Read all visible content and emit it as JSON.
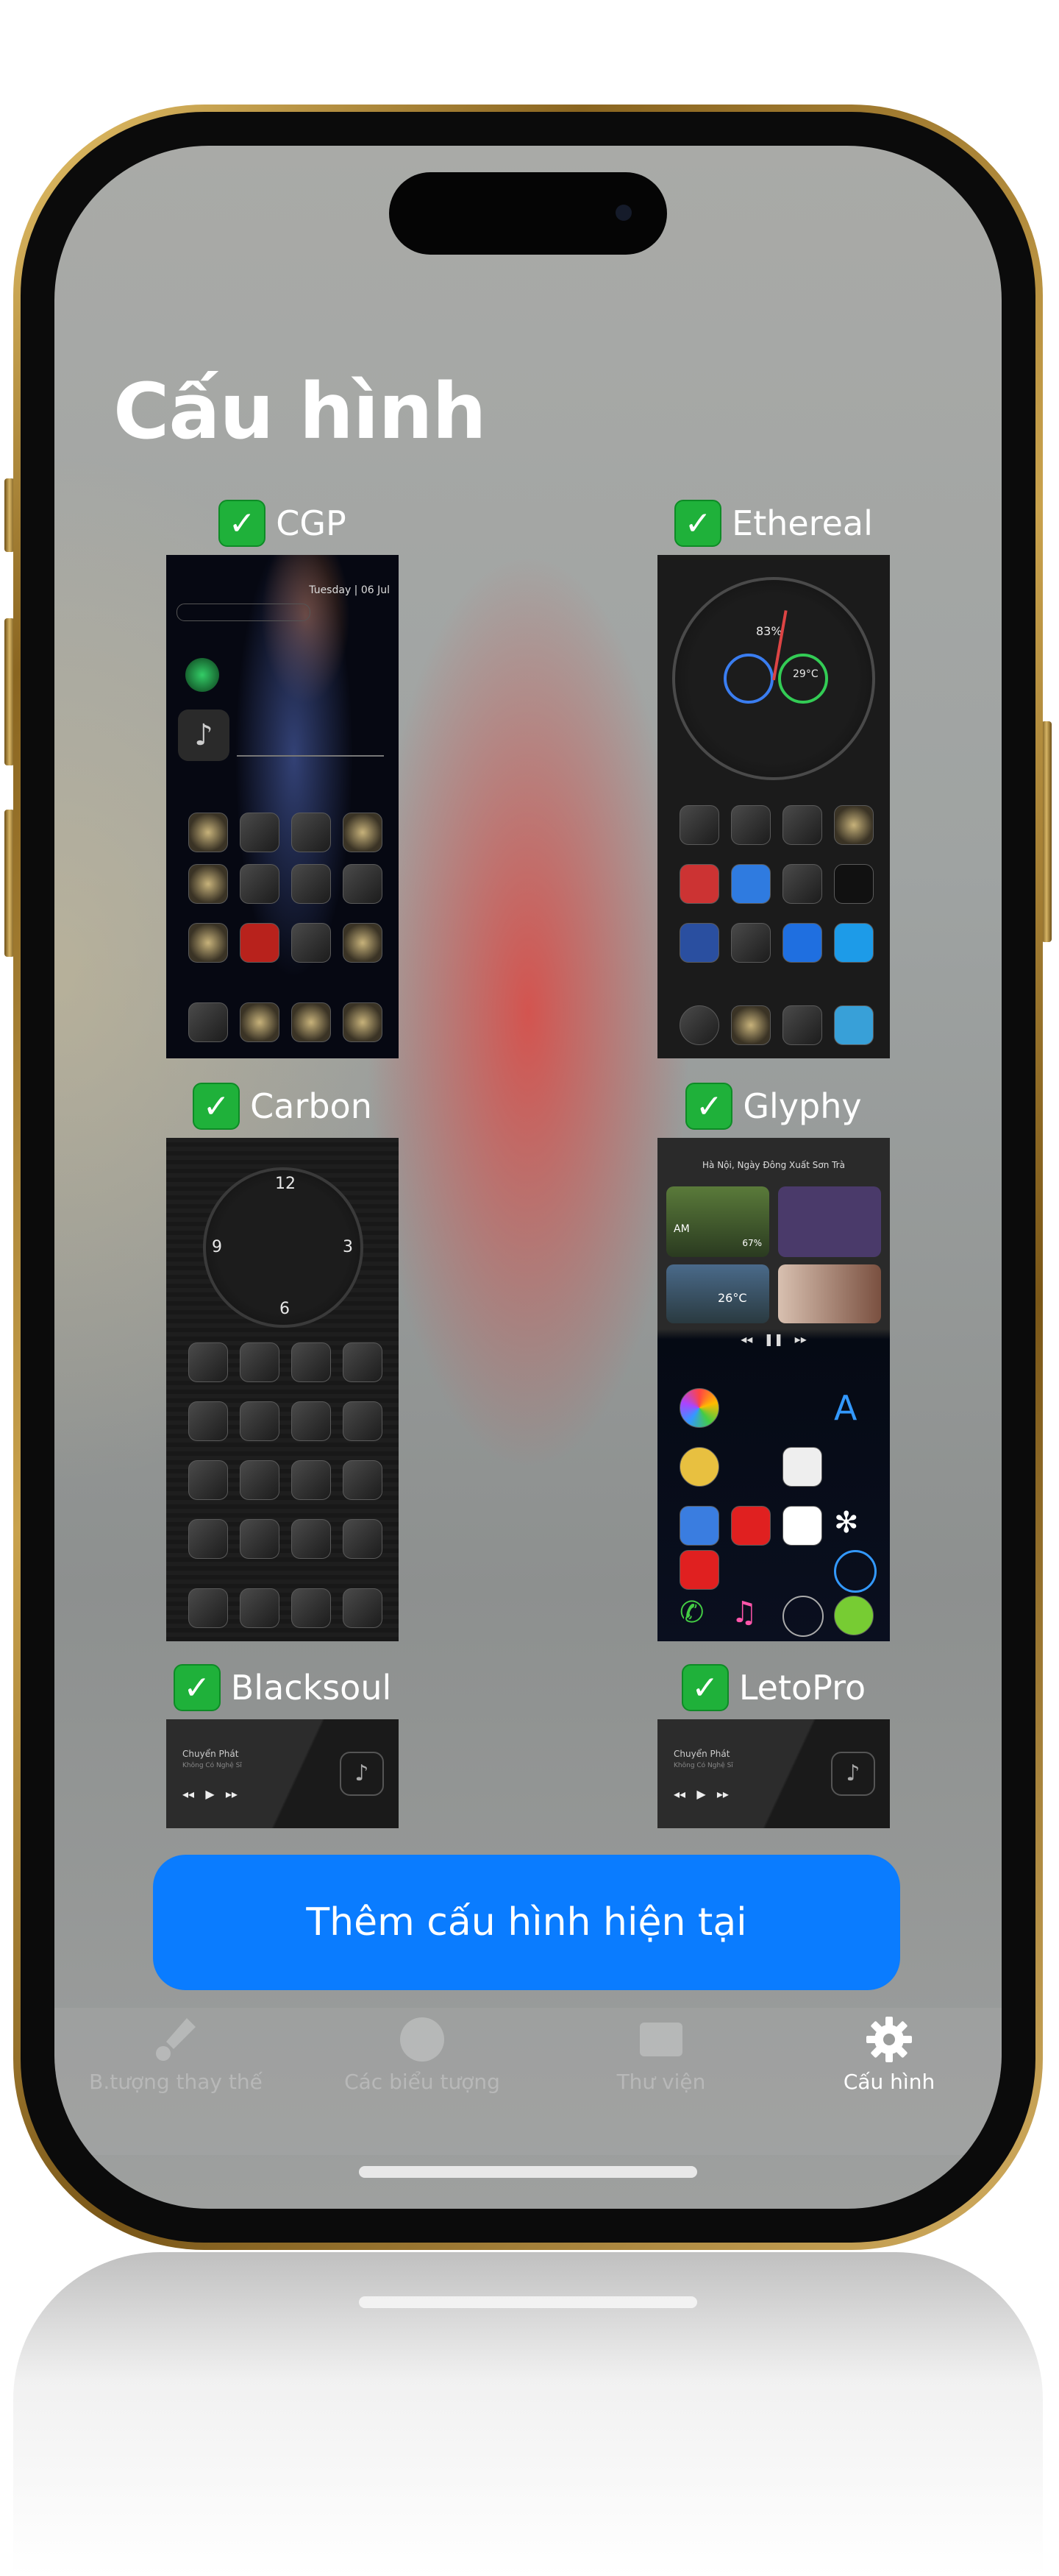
{
  "screen": {
    "title": "Cấu hình"
  },
  "configs": [
    {
      "name": "CGP",
      "checked": true
    },
    {
      "name": "Ethereal",
      "checked": true
    },
    {
      "name": "Carbon",
      "checked": true
    },
    {
      "name": "Glyphy",
      "checked": true
    },
    {
      "name": "Blacksoul",
      "checked": true
    },
    {
      "name": "LetoPro",
      "checked": true
    }
  ],
  "check_glyph": "✓",
  "thumbs": {
    "cgp_date": "Tuesday | 06 Jul",
    "ethereal_battery": "83%",
    "ethereal_temp": "29°C",
    "glyphy_header": "Hà Nội, Ngày Đông Xuất Sơn Trà",
    "glyphy_am": "AM",
    "glyphy_pct": "67%",
    "glyphy_temp": "26°C",
    "music_title": "Chuyển Phát",
    "music_sub": "Không Có Nghệ Sĩ"
  },
  "add_button": {
    "label": "Thêm cấu hình hiện tại"
  },
  "tabs": [
    {
      "label": "B.tượng thay thế",
      "icon": "brush-icon"
    },
    {
      "label": "Các biểu tượng",
      "icon": "palette-icon"
    },
    {
      "label": "Thư viện",
      "icon": "library-icon"
    },
    {
      "label": "Cấu hình",
      "icon": "gear-icon"
    }
  ],
  "colors": {
    "accent": "#0a7cff",
    "check": "#1fb13a",
    "frame_gold": "#c9a24d"
  }
}
